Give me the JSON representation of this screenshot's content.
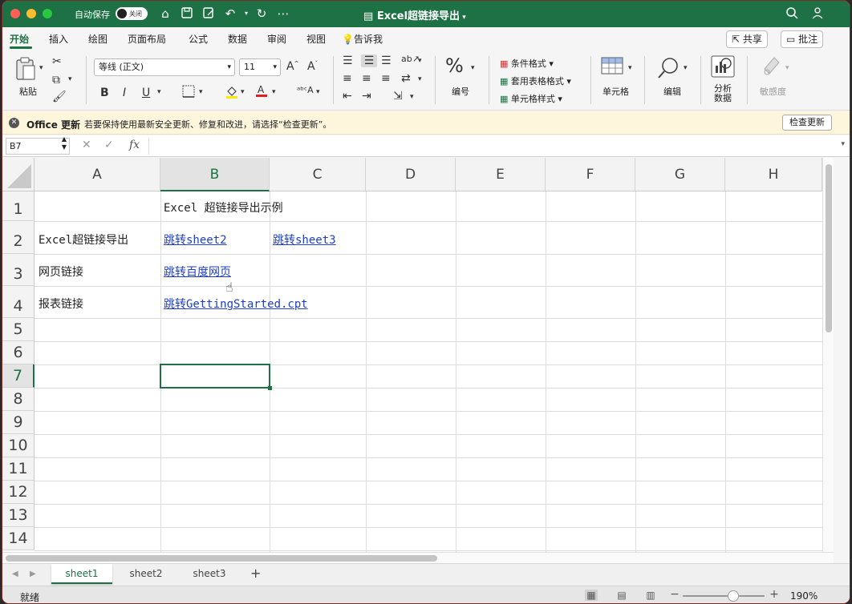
{
  "titlebar": {
    "autosave_label": "自动保存",
    "autosave_state": "关闭",
    "doc_title": "Excel超链接导出"
  },
  "menu": {
    "tabs": [
      "开始",
      "插入",
      "绘图",
      "页面布局",
      "公式",
      "数据",
      "审阅",
      "视图",
      "告诉我"
    ],
    "share": "共享",
    "comment": "批注"
  },
  "ribbon": {
    "paste": "粘贴",
    "font_name": "等线 (正文)",
    "font_size": "11",
    "bold": "B",
    "italic": "I",
    "underline": "U",
    "number_format": "编号",
    "cond_format": "条件格式",
    "table_format": "套用表格格式",
    "cell_style": "单元格样式",
    "cells": "单元格",
    "edit": "编辑",
    "analyze_line1": "分析",
    "analyze_line2": "数据",
    "sensitivity": "敏感度"
  },
  "notification": {
    "title": "Office 更新",
    "message": "若要保持使用最新安全更新、修复和改进，请选择“检查更新”。",
    "button": "检查更新"
  },
  "formula_bar": {
    "name_box": "B7",
    "fx": "fx",
    "value": ""
  },
  "columns": [
    "A",
    "B",
    "C",
    "D",
    "E",
    "F",
    "G",
    "H"
  ],
  "rows": [
    "1",
    "2",
    "3",
    "4",
    "5",
    "6",
    "7",
    "8",
    "9",
    "10",
    "11",
    "12",
    "13",
    "14"
  ],
  "cells": {
    "B1": "Excel 超链接导出示例",
    "A2": "Excel超链接导出",
    "B2": "跳转sheet2",
    "C2": "跳转sheet3",
    "A3": "网页链接",
    "B3": "跳转百度网页",
    "A4": "报表链接",
    "B4": "跳转GettingStarted.cpt"
  },
  "link_color": "#1f3fc0",
  "accent_color": "#1e7145",
  "sheets": [
    "sheet1",
    "sheet2",
    "sheet3"
  ],
  "active_sheet": "sheet1",
  "status": {
    "ready": "就绪",
    "zoom": "190%"
  }
}
